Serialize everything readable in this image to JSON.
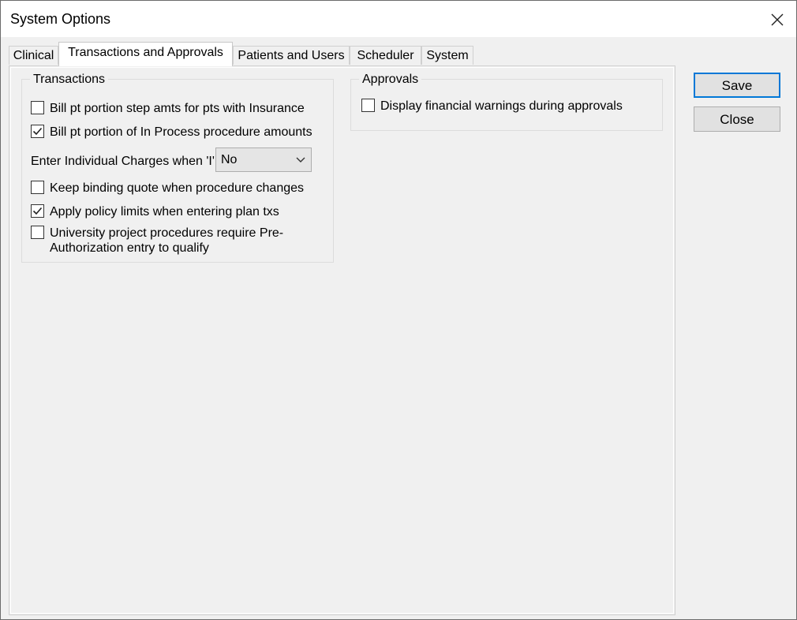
{
  "window": {
    "title": "System Options"
  },
  "tabs": [
    {
      "label": "Clinical",
      "active": false
    },
    {
      "label": "Transactions and Approvals",
      "active": true
    },
    {
      "label": "Patients and Users",
      "active": false
    },
    {
      "label": "Scheduler",
      "active": false
    },
    {
      "label": "System",
      "active": false
    }
  ],
  "transactions": {
    "title": "Transactions",
    "items": [
      {
        "label": "Bill pt portion step amts for pts with Insurance",
        "checked": false
      },
      {
        "label": "Bill pt portion of In Process procedure amounts",
        "checked": true
      },
      {
        "label": "Keep binding quote when procedure changes",
        "checked": false
      },
      {
        "label": "Apply policy limits when entering plan txs",
        "checked": true
      },
      {
        "label": "University project procedures require Pre-",
        "label2": "Authorization entry to qualify",
        "checked": false
      }
    ],
    "charges_label": "Enter Individual Charges when 'I'",
    "charges_value": "No"
  },
  "approvals": {
    "title": "Approvals",
    "items": [
      {
        "label": "Display financial warnings during approvals",
        "checked": false
      }
    ]
  },
  "buttons": {
    "save": "Save",
    "close": "Close"
  }
}
